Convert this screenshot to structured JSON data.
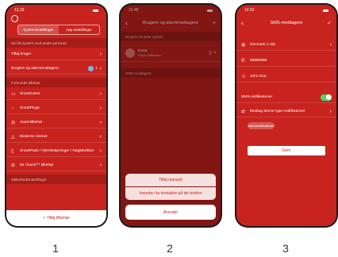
{
  "labels": [
    "1",
    "2",
    "3"
  ],
  "colors": {
    "accent": "#c8231e",
    "toggle_on": "#4cd964"
  },
  "phone1": {
    "time": "12.32",
    "tabs": [
      "Systemindstillinger",
      "App-indstillinger"
    ],
    "info": "Del dit system med andre personer",
    "rows": [
      {
        "label": "Tilføj bruger"
      },
      {
        "label": "Brugere og alarmmodtagere",
        "badge": "1"
      }
    ],
    "section1": "Forbundet tilbehør",
    "devices": [
      {
        "label": "SmartCams",
        "icon": "camera-icon"
      },
      {
        "label": "SmartPlugs",
        "icon": "plug-icon"
      },
      {
        "label": "Alarmtilbehør",
        "icon": "alarm-icon"
      },
      {
        "label": "Eksterne sirener",
        "icon": "siren-icon"
      },
      {
        "label": "SmartPads / Fjernbetjeninger / Nøglebrikker",
        "icon": "keypad-icon"
      },
      {
        "label": "55 iTouch™ tilbehør",
        "icon": "touch-icon"
      }
    ],
    "section2": "Sikkerhedsindstillinger",
    "add_button": "+ Tilføj tilbehør"
  },
  "phone2": {
    "time": "12.48",
    "title": "Brugere og alarmmodtagere",
    "section1": "Brugere af dette system",
    "user_name": "Rune",
    "user_sub": "Push-notifikation",
    "section2": "SMS-modtagere",
    "sheet_option1": "Tilføj manuelt",
    "sheet_option2": "Importer fra kontakter på din telefon",
    "cancel": "Annuller"
  },
  "phone3": {
    "time": "12.52",
    "title": "SMS-modtagere",
    "country": "Denmark (+45)",
    "phone": "88888888",
    "name": "John Doe",
    "toggle_label": "SMS-notifikationer",
    "receive_label": "Modtag denne type notifikationer",
    "pill": "Alarmnotifikationer",
    "save": "Gem"
  }
}
